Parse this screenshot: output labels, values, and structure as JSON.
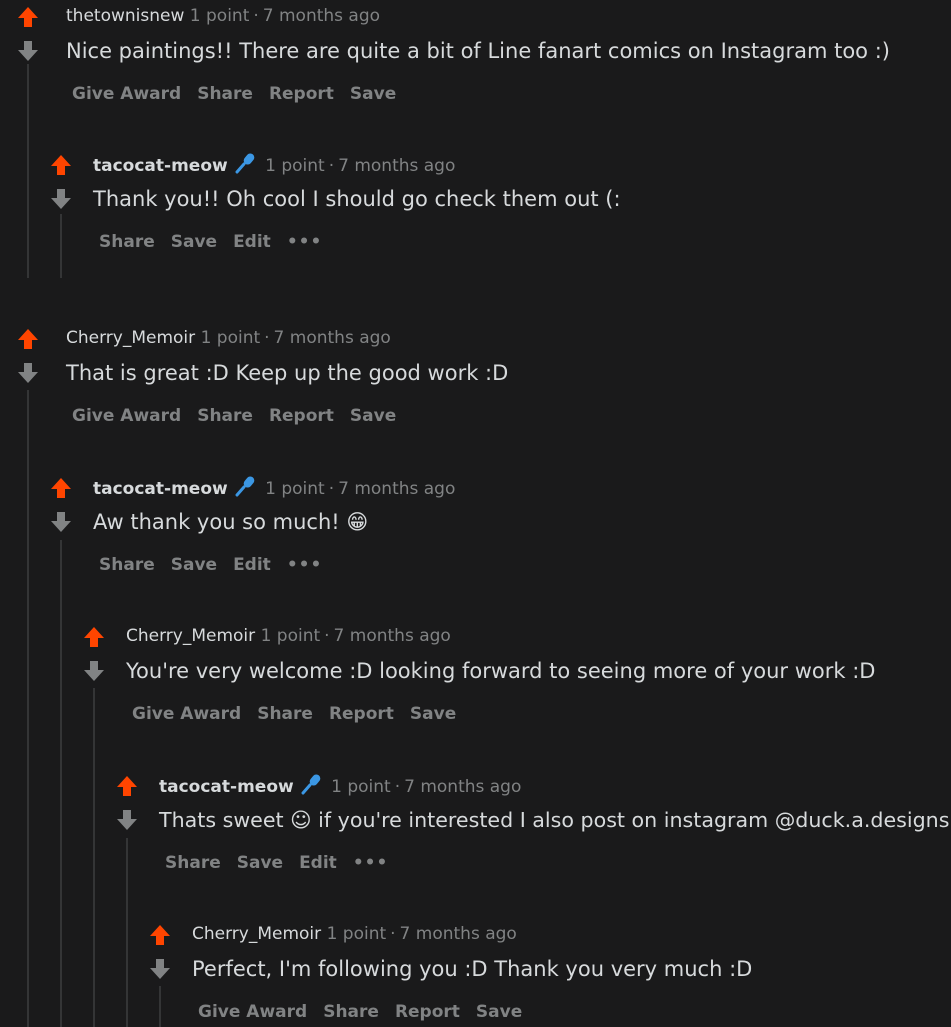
{
  "colors": {
    "upvote": "#ff4500",
    "downvote": "#818384",
    "mic": "#3b97e4",
    "background": "#1a1a1b"
  },
  "comments": [
    {
      "author": "thetownisnew",
      "points": "1 point",
      "time": "7 months ago",
      "body": "Nice paintings!! There are quite a bit of Line fanart comics on Instagram too :)",
      "actions": [
        "Give Award",
        "Share",
        "Report",
        "Save"
      ]
    },
    {
      "author": "tacocat-meow",
      "points": "1 point",
      "time": "7 months ago",
      "body": "Thank you!! Oh cool I should go check them out (:",
      "actions": [
        "Share",
        "Save",
        "Edit",
        "•••"
      ]
    },
    {
      "author": "Cherry_Memoir",
      "points": "1 point",
      "time": "7 months ago",
      "body": "That is great :D Keep up the good work :D",
      "actions": [
        "Give Award",
        "Share",
        "Report",
        "Save"
      ]
    },
    {
      "author": "tacocat-meow",
      "points": "1 point",
      "time": "7 months ago",
      "body": "Aw thank you so much! 😁",
      "actions": [
        "Share",
        "Save",
        "Edit",
        "•••"
      ]
    },
    {
      "author": "Cherry_Memoir",
      "points": "1 point",
      "time": "7 months ago",
      "body": "You're very welcome :D looking forward to seeing more of your work :D",
      "actions": [
        "Give Award",
        "Share",
        "Report",
        "Save"
      ]
    },
    {
      "author": "tacocat-meow",
      "points": "1 point",
      "time": "7 months ago",
      "body": "Thats sweet ☺ if you're interested I also post on instagram @duck.a.designs",
      "actions": [
        "Share",
        "Save",
        "Edit",
        "•••"
      ]
    },
    {
      "author": "Cherry_Memoir",
      "points": "1 point",
      "time": "7 months ago",
      "body": "Perfect, I'm following you :D Thank you very much :D",
      "actions": [
        "Give Award",
        "Share",
        "Report",
        "Save"
      ]
    }
  ],
  "separator": "·"
}
